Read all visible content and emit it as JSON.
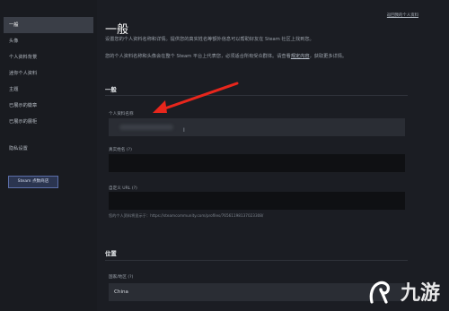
{
  "sidebar": {
    "items": [
      {
        "label": "一般",
        "active": true
      },
      {
        "label": "头像"
      },
      {
        "label": "个人资料背景"
      },
      {
        "label": "迷你个人资料"
      },
      {
        "label": "主题"
      },
      {
        "label": "已展示的徽章"
      },
      {
        "label": "已展示的展柜"
      }
    ],
    "privacy": "隐私设置",
    "steam_button": "Steam 点数商店"
  },
  "header": {
    "top_link": "返回我的个人资料"
  },
  "main": {
    "title": "一般",
    "intro_1": "设置您的个人资料名称和详情。提供您的真实姓名等额外信息可以帮助好友在 Steam 社区上找到您。",
    "intro_2_a": "您的个人资料名称和头像会在整个 Steam 平台上代表您，必须适合所有受众群体。请查看",
    "intro_2_link": "规定内容",
    "intro_2_b": "，获取更多详情。",
    "section_general": "一般",
    "profile_name_label": "个人资料名称",
    "real_name_label": "真实姓名 (?)",
    "custom_url_label": "自定义 URL (?)",
    "url_hint": "您的个人资料将显示于：https://steamcommunity.com/profiles/76561198137023308/",
    "section_location": "位置",
    "country_label": "国家/地区 (?)",
    "country_value": "China"
  },
  "watermark": {
    "text": "九游"
  },
  "colors": {
    "arrow": "#e8261c",
    "active_nav": "#3a3e47",
    "steam_button": "#2b3550"
  }
}
